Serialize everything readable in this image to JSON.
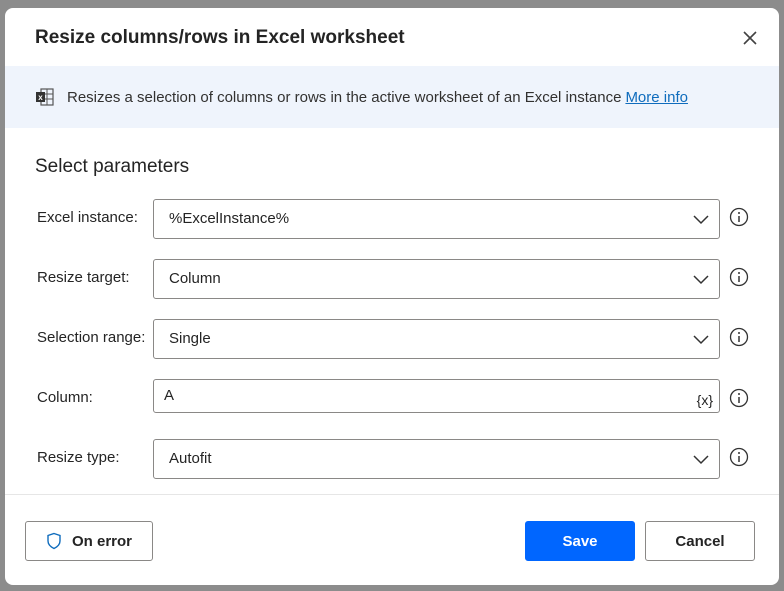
{
  "dialog": {
    "title": "Resize columns/rows in Excel worksheet",
    "description": "Resizes a selection of columns or rows in the active worksheet of an Excel instance",
    "more_info": "More info",
    "section_title": "Select parameters"
  },
  "params": [
    {
      "label": "Excel instance:",
      "value": "%ExcelInstance%",
      "type": "dropdown"
    },
    {
      "label": "Resize target:",
      "value": "Column",
      "type": "dropdown"
    },
    {
      "label": "Selection range:",
      "value": "Single",
      "type": "dropdown"
    },
    {
      "label": "Column:",
      "value": "A",
      "type": "text",
      "variable_button": "{x}"
    },
    {
      "label": "Resize type:",
      "value": "Autofit",
      "type": "dropdown"
    }
  ],
  "footer": {
    "on_error": "On error",
    "save": "Save",
    "cancel": "Cancel"
  },
  "colors": {
    "accent": "#0066ff",
    "banner": "#eff4fc",
    "link": "#0f6cbd"
  }
}
